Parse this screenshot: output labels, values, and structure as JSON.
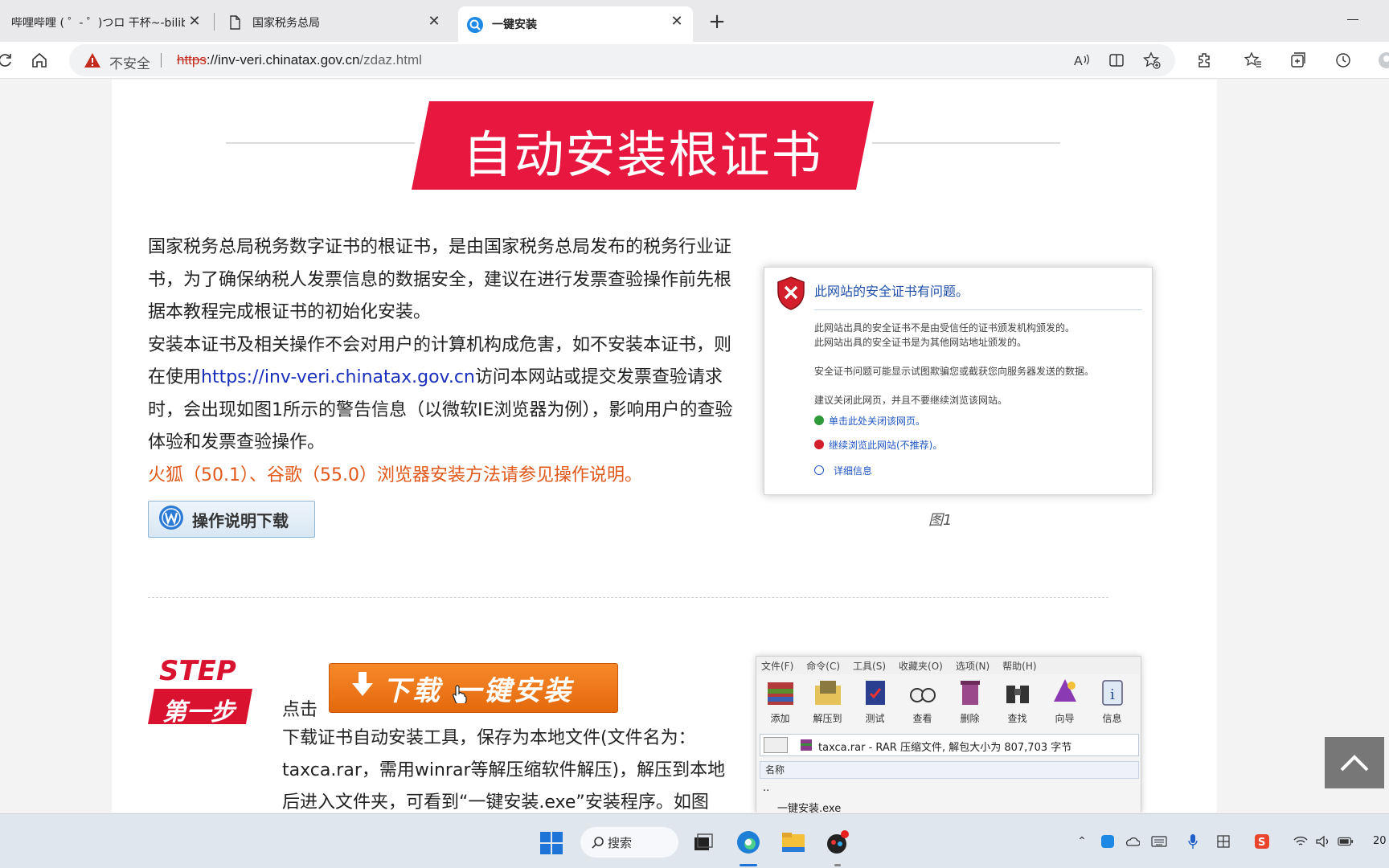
{
  "browser": {
    "tabs": [
      {
        "title": "哔哩哔哩 ( ゜- ゜)つロ 干杯~-bilibili"
      },
      {
        "title": "国家税务总局"
      },
      {
        "title": "一键安装"
      }
    ],
    "address": {
      "security_label": "不安全",
      "url_scheme": "https",
      "url_host": "://inv-veri.chinatax.gov.cn",
      "url_path": "/zdaz.html"
    }
  },
  "page": {
    "banner_title": "自动安装根证书",
    "intro": {
      "p1": "国家税务总局税务数字证书的根证书，是由国家税务总局发布的税务行业证书，为了确保纳税人发票信息的数据安全，建议在进行发票查验操作前先根据本教程完成根证书的初始化安装。",
      "p2_before": "安装本证书及相关操作不会对用户的计算机构成危害，如不安装本证书，则在使用",
      "p2_link": "https://inv-veri.chinatax.gov.cn",
      "p2_after": "访问本网站或提交发票查验请求时，会出现如图1所示的警告信息（以微软IE浏览器为例），影响用户的查验体验和发票查验操作。",
      "note": "火狐（50.1）、谷歌（55.0）浏览器安装方法请参见操作说明。"
    },
    "doc_button_label": "操作说明下载",
    "figure1": {
      "title": "此网站的安全证书有问题。",
      "line1": "此网站出具的安全证书不是由受信任的证书颁发机构颁发的。",
      "line2": "此网站出具的安全证书是为其他网站地址颁发的。",
      "line3": "安全证书问题可能显示试图欺骗您或截获您向服务器发送的数据。",
      "line4": "建议关闭此网页，并且不要继续浏览该网站。",
      "link_close": "单击此处关闭该网页。",
      "link_continue": "继续浏览此网站(不推荐)。",
      "link_details": "详细信息",
      "caption": "图1"
    },
    "step1": {
      "step_en": "STEP 1",
      "step_cn": "第一步",
      "click_label": "点击",
      "download_button": "下载 一键安装",
      "text": "下载证书自动安装工具，保存为本地文件(文件名为：taxca.rar，需用winrar等解压缩软件解压)，解压到本地后进入文件夹，可看到“一键安装.exe”安装程序。如图"
    },
    "figure2": {
      "menu": [
        "文件(F)",
        "命令(C)",
        "工具(S)",
        "收藏夹(O)",
        "选项(N)",
        "帮助(H)"
      ],
      "tools": [
        "添加",
        "解压到",
        "测试",
        "查看",
        "删除",
        "查找",
        "向导",
        "信息"
      ],
      "path_text": "taxca.rar - RAR 压缩文件, 解包大小为 807,703 字节",
      "column_name": "名称",
      "rows": [
        "..",
        "一键安装.exe"
      ]
    }
  },
  "taskbar": {
    "search_label": "搜索",
    "clock": "20"
  },
  "colors": {
    "banner_red": "#e8173f",
    "note_orange": "#e0581a",
    "link_blue": "#1a2fbd",
    "download_orange": "#f07a1e"
  }
}
